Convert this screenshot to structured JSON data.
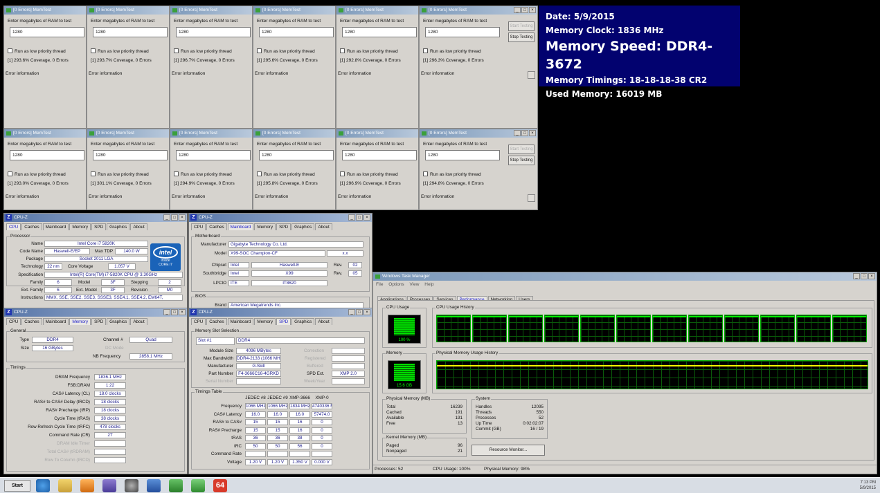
{
  "memtest": {
    "title": "[0 Errors] MemTest",
    "enter_label": "Enter megabytes of RAM to test",
    "value": "1280",
    "low_priority": "Run as low priority thread",
    "error_info": "Error information",
    "start": "Start Testing",
    "stop": "Stop Testing",
    "coverage": [
      "[1]  293.6% Coverage, 0 Errors",
      "[1]  293.7% Coverage, 0 Errors",
      "[1]  296.7% Coverage, 0 Errors",
      "[1]  295.6% Coverage, 0 Errors",
      "[1]  292.8% Coverage, 0 Errors",
      "[1]  296.3% Coverage, 0 Errors",
      "[1]  293.0% Coverage, 0 Errors",
      "[1]  301.1% Coverage, 0 Errors",
      "[1]  294.9% Coverage, 0 Errors",
      "[1]  295.8% Coverage, 0 Errors",
      "[1]  296.9% Coverage, 0 Errors",
      "[1]  294.8% Coverage, 0 Errors"
    ]
  },
  "info": {
    "date": "Date: 5/9/2015",
    "clock": "Memory Clock: 1836 MHz",
    "speed": "Memory Speed: DDR4-3672",
    "timings": "Memory Timings: 18-18-18-38 CR2",
    "used": "Used Memory: 16019 MB"
  },
  "cpuz": {
    "title": "CPU-Z",
    "tabs": [
      "CPU",
      "Caches",
      "Mainboard",
      "Memory",
      "SPD",
      "Graphics",
      "About"
    ],
    "cpu": {
      "group": "Processor",
      "name_l": "Name",
      "name": "Intel Core i7 5820K",
      "code_l": "Code Name",
      "code": "Haswell-E/EP",
      "tdp_l": "Max TDP",
      "tdp": "140.0 W",
      "pkg_l": "Package",
      "pkg": "Socket 2011 LGA",
      "tech_l": "Technology",
      "tech": "22 nm",
      "volt_l": "Core Voltage",
      "volt": "1.057 V",
      "spec_l": "Specification",
      "spec": "Intel(R) Core(TM) i7-5820K CPU @ 3.30GHz",
      "fam_l": "Family",
      "fam": "6",
      "model_l": "Model",
      "model": "3F",
      "step_l": "Stepping",
      "step": "2",
      "efam_l": "Ext. Family",
      "efam": "6",
      "emod_l": "Ext. Model",
      "emod": "3F",
      "rev_l": "Revision",
      "rev": "M0",
      "instr_l": "Instructions",
      "instr": "MMX, SSE, SSE2, SSE3, SSSE3, SSE4.1, SSE4.2, EM64T,",
      "logo": "intel",
      "logo_sub": "inside",
      "logo_core": "CORE i7"
    },
    "mb": {
      "group": "Motherboard",
      "manu_l": "Manufacturer",
      "manu": "Gigabyte Technology Co. Ltd.",
      "model_l": "Model",
      "model": "X99-SOC Champion-CF",
      "model_rev": "x.x",
      "chip_l": "Chipset",
      "chip_v": "Intel",
      "chip": "Haswell-E",
      "chip_rev_l": "Rev.",
      "chip_rev": "02",
      "sb_l": "Southbridge",
      "sb_v": "Intel",
      "sb": "X99",
      "sb_rev": "05",
      "lpc_l": "LPCIO",
      "lpc_v": "ITE",
      "lpc": "IT8620",
      "bios_group": "BIOS",
      "brand_l": "Brand",
      "brand": "American Megatrends Inc."
    },
    "mem": {
      "group": "General",
      "type_l": "Type",
      "type": "DDR4",
      "chan_l": "Channel #",
      "chan": "Quad",
      "size_l": "Size",
      "size": "16 GBytes",
      "dc": "DC Mode",
      "nbf_l": "NB Frequency",
      "nbf": "2858.1 MHz",
      "timing_group": "Timings",
      "rows": [
        [
          "DRAM Frequency",
          "1836.1 MHz"
        ],
        [
          "FSB:DRAM",
          "1:22"
        ],
        [
          "CAS# Latency (CL)",
          "18.0 clocks"
        ],
        [
          "RAS# to CAS# Delay (tRCD)",
          "18 clocks"
        ],
        [
          "RAS# Precharge (tRP)",
          "18 clocks"
        ],
        [
          "Cycle Time (tRAS)",
          "38 clocks"
        ],
        [
          "Row Refresh Cycle Time (tRFC)",
          "478 clocks"
        ],
        [
          "Command Rate (CR)",
          "2T"
        ]
      ],
      "grey": [
        "DRAM Idle Timer",
        "Total CAS# (tRDRAM)",
        "Row To Column (tRCD)"
      ]
    },
    "spd": {
      "group": "Memory Slot Selection",
      "slot": "Slot #1",
      "slot_type": "DDR4",
      "mod_l": "Module Size",
      "mod": "4096 MBytes",
      "corr": "Correction",
      "bw_l": "Max Bandwidth",
      "bw": "DDR4-2133 (1066 MHz)",
      "reg": "Registered",
      "man_l": "Manufacturer",
      "man": "G.Skill",
      "buf": "Buffered",
      "pn_l": "Part Number",
      "pn": "F4-3666C16-4GRKD",
      "spd_l": "SPD Ext.",
      "spd": "XMP 2.0",
      "sn_l": "Serial Number",
      "wk": "Week/Year",
      "tt_group": "Timings Table",
      "cols": [
        "JEDEC #8",
        "JEDEC #9",
        "XMP-3666",
        "XMP-0"
      ],
      "rows": [
        [
          "Frequency",
          "1066 MHz",
          "1066 MHz",
          "1834 MHz",
          "4740336 MHz"
        ],
        [
          "CAS# Latency",
          "16.0",
          "16.0",
          "16.0",
          "57474.0"
        ],
        [
          "RAS# to CAS#",
          "15",
          "15",
          "16",
          "0"
        ],
        [
          "RAS# Precharge",
          "15",
          "15",
          "16",
          "0"
        ],
        [
          "tRAS",
          "36",
          "36",
          "38",
          "0"
        ],
        [
          "tRC",
          "50",
          "50",
          "56",
          "0"
        ],
        [
          "Command Rate",
          "",
          "",
          "",
          ""
        ],
        [
          "Voltage",
          "1.20 V",
          "1.20 V",
          "1.350 V",
          "0.000 V"
        ]
      ]
    }
  },
  "tm": {
    "title": "Windows Task Manager",
    "menu": "File Options View Help",
    "tabs": [
      "Applications",
      "Processes",
      "Services",
      "Performance",
      "Networking",
      "Users"
    ],
    "cpu_usage": "CPU Usage",
    "cpu_pct": "100 %",
    "cpu_hist": "CPU Usage History",
    "mem": "Memory",
    "mem_val": "15.6 GB",
    "mem_hist": "Physical Memory Usage History",
    "phys": {
      "title": "Physical Memory (MB)",
      "rows": [
        [
          "Total",
          "16239"
        ],
        [
          "Cached",
          "191"
        ],
        [
          "Available",
          "191"
        ],
        [
          "Free",
          "13"
        ]
      ]
    },
    "sys": {
      "title": "System",
      "rows": [
        [
          "Handles",
          "12095"
        ],
        [
          "Threads",
          "550"
        ],
        [
          "Processes",
          "52"
        ],
        [
          "Up Time",
          "0:02:02:07"
        ],
        [
          "Commit (GB)",
          "16 / 19"
        ]
      ]
    },
    "kern": {
      "title": "Kernel Memory (MB)",
      "rows": [
        [
          "Paged",
          "96"
        ],
        [
          "Nonpaged",
          "21"
        ]
      ]
    },
    "res": "Resource Monitor...",
    "st_proc": "Processes: 52",
    "st_cpu": "CPU Usage: 100%",
    "st_mem": "Physical Memory: 98%"
  },
  "taskbar": {
    "start": "Start",
    "badge": "64",
    "time": "7:13 PM",
    "date": "5/9/2015"
  }
}
